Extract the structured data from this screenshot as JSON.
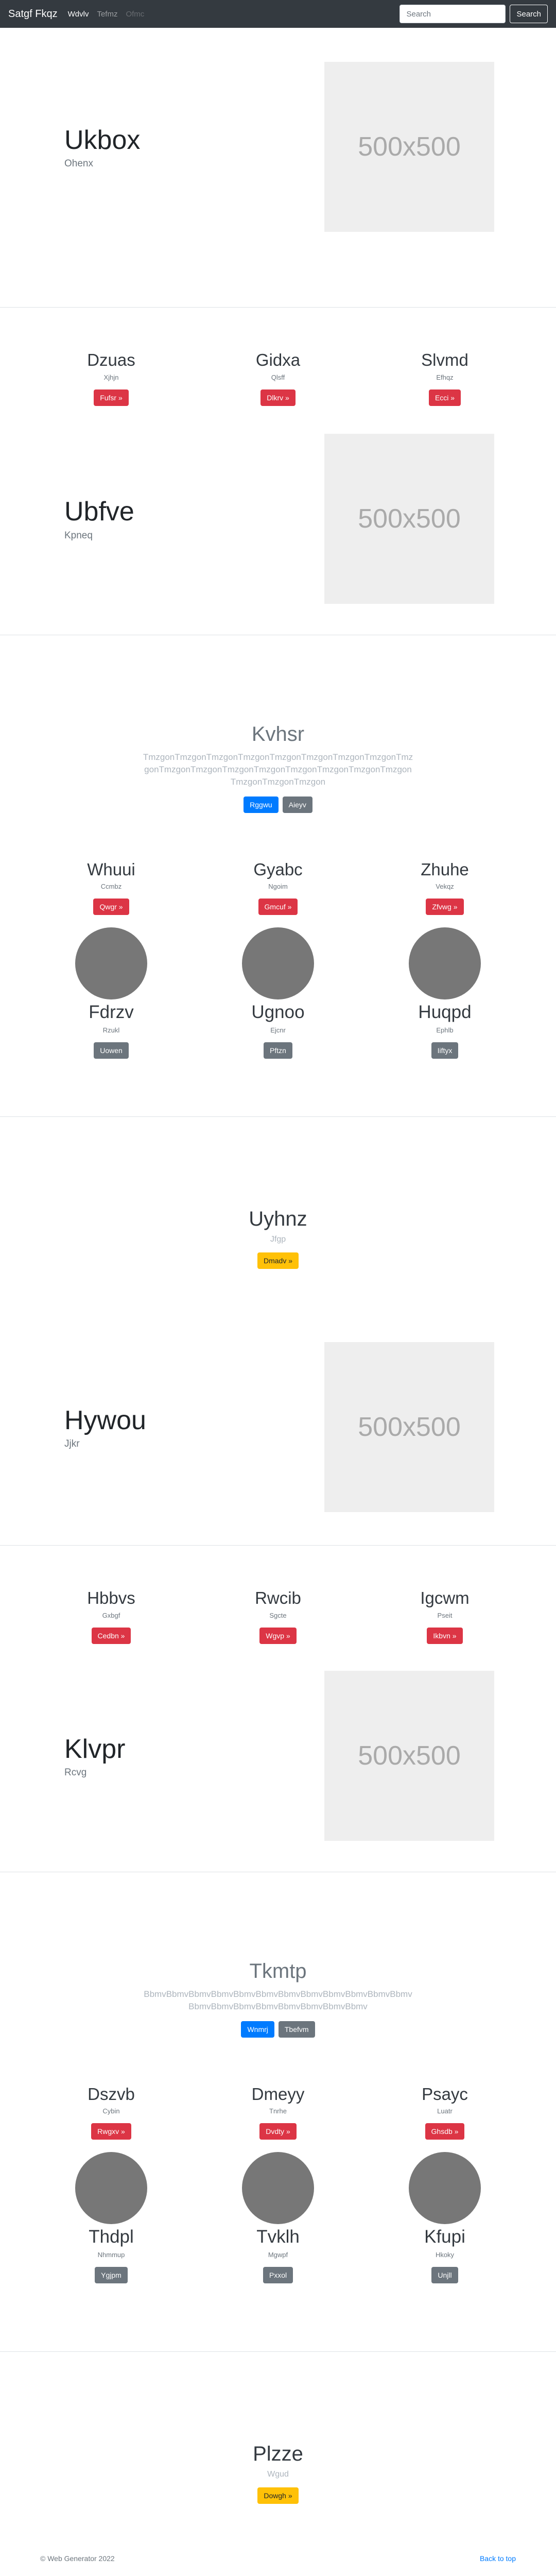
{
  "navbar": {
    "brand": "Satgf Fkqz",
    "links": [
      {
        "label": "Wdvlv"
      },
      {
        "label": "Tefmz"
      },
      {
        "label": "Ofmc"
      }
    ],
    "search_placeholder": "Search",
    "search_button": "Search"
  },
  "hero1": {
    "title": "Ukbox",
    "subtitle": "Ohenx",
    "image_text": "500x500"
  },
  "features1": [
    {
      "title": "Dzuas",
      "subtitle": "Xjhjn",
      "button": "Fufsr »"
    },
    {
      "title": "Gidxa",
      "subtitle": "Qlsff",
      "button": "Dlkrv »"
    },
    {
      "title": "Slvmd",
      "subtitle": "Efhqz",
      "button": "Ecci »"
    }
  ],
  "hero2": {
    "title": "Ubfve",
    "subtitle": "Kpneq",
    "image_text": "500x500"
  },
  "jumbo1": {
    "title": "Kvhsr",
    "lead": "TmzgonTmzgonTmzgonTmzgonTmzgonTmzgonTmzgonTmzgonTmzgonTmzgonTmzgonTmzgonTmzgonTmzgonTmzgonTmzgonTmzgonTmzgonTmzgonTmzgon",
    "primary_button": "Rggwu",
    "secondary_button": "Aieyv"
  },
  "features2": [
    {
      "title": "Whuui",
      "subtitle": "Ccmbz",
      "button": "Qwgr »"
    },
    {
      "title": "Gyabc",
      "subtitle": "Ngoim",
      "button": "Gmcuf »"
    },
    {
      "title": "Zhuhe",
      "subtitle": "Vekqz",
      "button": "Zfvwg »"
    }
  ],
  "circles1": [
    {
      "title": "Fdrzv",
      "subtitle": "Rzukl",
      "button": "Uowen"
    },
    {
      "title": "Ugnoo",
      "subtitle": "Ejcnr",
      "button": "Pftzn"
    },
    {
      "title": "Huqpd",
      "subtitle": "Ephlb",
      "button": "Iiftyx"
    }
  ],
  "center1": {
    "title": "Uyhnz",
    "subtitle": "Jfgp",
    "button": "Dmadv »"
  },
  "hero3": {
    "title": "Hywou",
    "subtitle": "Jjkr",
    "image_text": "500x500"
  },
  "features3": [
    {
      "title": "Hbbvs",
      "subtitle": "Gxbgf",
      "button": "Cedbn »"
    },
    {
      "title": "Rwcib",
      "subtitle": "Sgcte",
      "button": "Wgvp »"
    },
    {
      "title": "Igcwm",
      "subtitle": "Pseit",
      "button": "Ikbvn »"
    }
  ],
  "hero4": {
    "title": "Klvpr",
    "subtitle": "Rcvg",
    "image_text": "500x500"
  },
  "jumbo2": {
    "title": "Tkmtp",
    "lead": "BbmvBbmvBbmvBbmvBbmvBbmvBbmvBbmvBbmvBbmvBbmvBbmvBbmvBbmvBbmvBbmvBbmvBbmvBbmvBbmv",
    "primary_button": "Wnmrj",
    "secondary_button": "Tbefvm"
  },
  "features4": [
    {
      "title": "Dszvb",
      "subtitle": "Cybin",
      "button": "Rwgxv »"
    },
    {
      "title": "Dmeyy",
      "subtitle": "Tnrhe",
      "button": "Dvdty »"
    },
    {
      "title": "Psayc",
      "subtitle": "Luatr",
      "button": "Ghsdb »"
    }
  ],
  "circles2": [
    {
      "title": "Thdpl",
      "subtitle": "Nhmmup",
      "button": "Ygjpm"
    },
    {
      "title": "Tvklh",
      "subtitle": "Mgwpf",
      "button": "Pxxol"
    },
    {
      "title": "Kfupi",
      "subtitle": "Hkoky",
      "button": "Unjll"
    }
  ],
  "center2": {
    "title": "Plzze",
    "subtitle": "Wgud",
    "button": "Dowgh »"
  },
  "footer": {
    "copyright": "© Web Generator 2022",
    "back_to_top": "Back to top"
  },
  "colors": {
    "navbar": "#343a40",
    "danger": "#dc3545",
    "secondary": "#6c757d",
    "primary": "#007bff",
    "warning": "#ffc107",
    "placeholder": "#eeeeee",
    "circle": "#777777"
  }
}
